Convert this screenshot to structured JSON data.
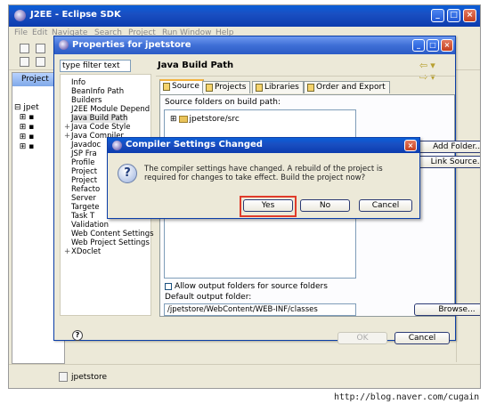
{
  "eclipse": {
    "title": "J2EE - Eclipse SDK",
    "menu": [
      "File",
      "Edit",
      "Navigate",
      "Search",
      "Project",
      "Run",
      "Window",
      "Help"
    ],
    "left_panel_tab": "Project",
    "tree_root": "jpet",
    "status_text": "jpetstore"
  },
  "properties_dialog": {
    "title": "Properties for jpetstore",
    "filter_text": "type filter text",
    "categories": [
      {
        "label": "Info",
        "expandable": false
      },
      {
        "label": "BeanInfo Path",
        "expandable": false
      },
      {
        "label": "Builders",
        "expandable": false
      },
      {
        "label": "J2EE Module Depend",
        "expandable": false
      },
      {
        "label": "Java Build Path",
        "expandable": false,
        "selected": true
      },
      {
        "label": "Java Code Style",
        "expandable": true
      },
      {
        "label": "Java Compiler",
        "expandable": true
      },
      {
        "label": "Javadoc",
        "expandable": false
      },
      {
        "label": "JSP Fra",
        "expandable": false
      },
      {
        "label": "Profile",
        "expandable": false
      },
      {
        "label": "Project",
        "expandable": false
      },
      {
        "label": "Project",
        "expandable": false
      },
      {
        "label": "Refacto",
        "expandable": false
      },
      {
        "label": "Server",
        "expandable": false
      },
      {
        "label": "Targete",
        "expandable": false
      },
      {
        "label": "Task T",
        "expandable": false
      },
      {
        "label": "Validation",
        "expandable": false
      },
      {
        "label": "Web Content Settings",
        "expandable": false
      },
      {
        "label": "Web Project Settings",
        "expandable": false
      },
      {
        "label": "XDoclet",
        "expandable": true
      }
    ],
    "page_title": "Java Build Path",
    "tabs": [
      "Source",
      "Projects",
      "Libraries",
      "Order and Export"
    ],
    "source_folders_label": "Source folders on build path:",
    "source_folder_item": "jpetstore/src",
    "buttons": {
      "add_folder": "Add Folder...",
      "link_source": "Link Source...",
      "browse": "Browse...",
      "ok": "OK",
      "cancel": "Cancel"
    },
    "allow_output_label": "Allow output folders for source folders",
    "default_output_label": "Default output folder:",
    "default_output_value": "/jpetstore/WebContent/WEB-INF/classes"
  },
  "compiler_dialog": {
    "title": "Compiler Settings Changed",
    "message": "The compiler settings have changed. A rebuild of the project is required for changes to take effect. Build the project now?",
    "buttons": {
      "yes": "Yes",
      "no": "No",
      "cancel": "Cancel"
    }
  },
  "watermark": "http://blog.naver.com/cugain",
  "colors": {
    "title_blue": "#0a5fd8",
    "highlight_red": "#e03b2a",
    "dialog_bg": "#ece9d8"
  }
}
